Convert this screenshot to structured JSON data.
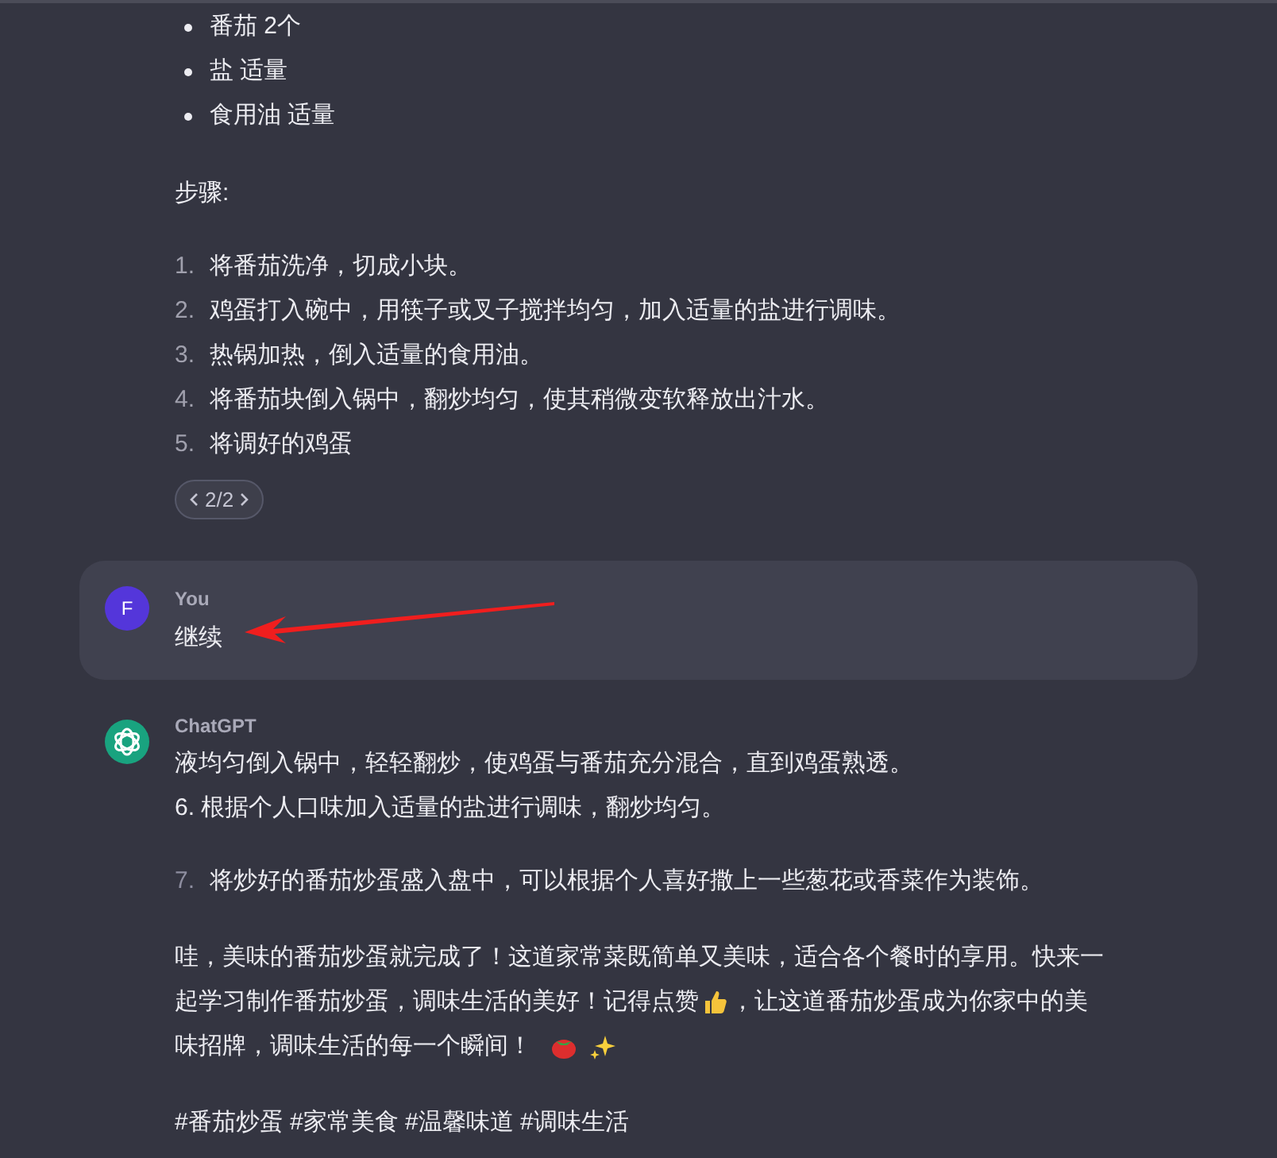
{
  "previous_reply": {
    "bullets": [
      "番茄 2个",
      "盐 适量",
      "食用油 适量"
    ],
    "steps_heading": "步骤:",
    "steps": [
      {
        "number": "1.",
        "text": "将番茄洗净，切成小块。"
      },
      {
        "number": "2.",
        "text": "鸡蛋打入碗中，用筷子或叉子搅拌均匀，加入适量的盐进行调味。"
      },
      {
        "number": "3.",
        "text": "热锅加热，倒入适量的食用油。"
      },
      {
        "number": "4.",
        "text": "将番茄块倒入锅中，翻炒均匀，使其稍微变软释放出汁水。"
      },
      {
        "number": "5.",
        "text": "将调好的鸡蛋"
      }
    ],
    "pager": "2/2"
  },
  "user_message": {
    "avatar": "F",
    "author": "You",
    "text": "继续"
  },
  "assistant_message": {
    "author": "ChatGPT",
    "lines": [
      "液均匀倒入锅中，轻轻翻炒，使鸡蛋与番茄充分混合，直到鸡蛋熟透。",
      "6. 根据个人口味加入适量的盐进行调味，翻炒均匀。"
    ],
    "step": {
      "number": "7.",
      "text": "将炒好的番茄炒蛋盛入盘中，可以根据个人喜好撒上一些葱花或香菜作为装饰。"
    },
    "closing": [
      [
        {
          "kind": "text",
          "text": "哇，美味的番茄炒蛋就完成了！这道家常菜既简单又美味，适合各个餐时的享用。快来一"
        }
      ],
      [
        {
          "kind": "text",
          "text": "起学习制作番茄炒蛋，调味生活的美好！记得点赞"
        },
        {
          "kind": "thumbs"
        },
        {
          "kind": "text",
          "text": "，让这道番茄炒蛋成为你家中的美"
        }
      ],
      [
        {
          "kind": "text",
          "text": "味招牌，调味生活的每一个瞬间！"
        },
        {
          "kind": "tomato"
        },
        {
          "kind": "sparkles"
        }
      ]
    ],
    "hashtags": "#番茄炒蛋 #家常美食 #温馨味道 #调味生活"
  }
}
